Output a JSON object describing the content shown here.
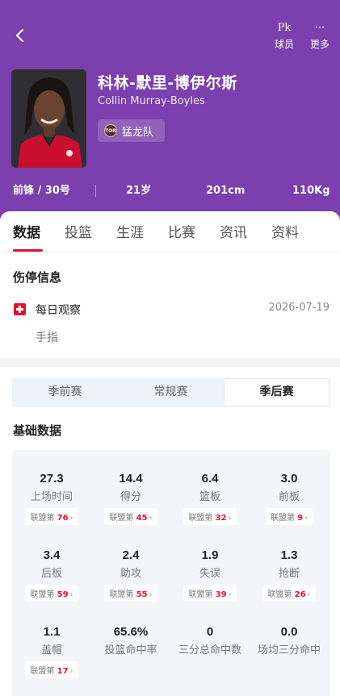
{
  "header": {
    "back_label": "",
    "player_icon_glyph": "Pk",
    "player_label": "球员",
    "more_icon_glyph": "···",
    "more_label": "更多"
  },
  "player": {
    "name_cn": "科林-默里-博伊尔斯",
    "name_en": "Collin Murray-Boyles",
    "team": "猛龙队",
    "position": "前锋 / 30号",
    "age": "21岁",
    "height": "201cm",
    "weight": "110Kg"
  },
  "tabs": [
    {
      "label": "数据",
      "active": true
    },
    {
      "label": "投篮"
    },
    {
      "label": "生涯"
    },
    {
      "label": "比赛"
    },
    {
      "label": "资讯"
    },
    {
      "label": "资料"
    }
  ],
  "injury": {
    "title": "伤停信息",
    "status": "每日观察",
    "date": "2026-07-19",
    "part": "手指"
  },
  "season_tabs": [
    {
      "label": "季前赛"
    },
    {
      "label": "常规赛"
    },
    {
      "label": "季后赛",
      "active": true
    }
  ],
  "basic": {
    "title": "基础数据",
    "rank_prefix": "联盟第",
    "items": [
      {
        "value": "27.3",
        "label": "上场时间",
        "rank": "76"
      },
      {
        "value": "14.4",
        "label": "得分",
        "rank": "45"
      },
      {
        "value": "6.4",
        "label": "篮板",
        "rank": "32"
      },
      {
        "value": "3.0",
        "label": "前板",
        "rank": "9"
      },
      {
        "value": "3.4",
        "label": "后板",
        "rank": "59"
      },
      {
        "value": "2.4",
        "label": "助攻",
        "rank": "55"
      },
      {
        "value": "1.9",
        "label": "失误",
        "rank": "39"
      },
      {
        "value": "1.3",
        "label": "抢断",
        "rank": "26"
      },
      {
        "value": "1.1",
        "label": "盖帽",
        "rank": "17"
      },
      {
        "value": "65.6%",
        "label": "投篮命中率"
      },
      {
        "value": "0",
        "label": "三分总命中数"
      },
      {
        "value": "0.0",
        "label": "场均三分命中"
      }
    ]
  },
  "colors": {
    "header_bg": "#7b3fae",
    "accent_red": "#e8112d"
  }
}
